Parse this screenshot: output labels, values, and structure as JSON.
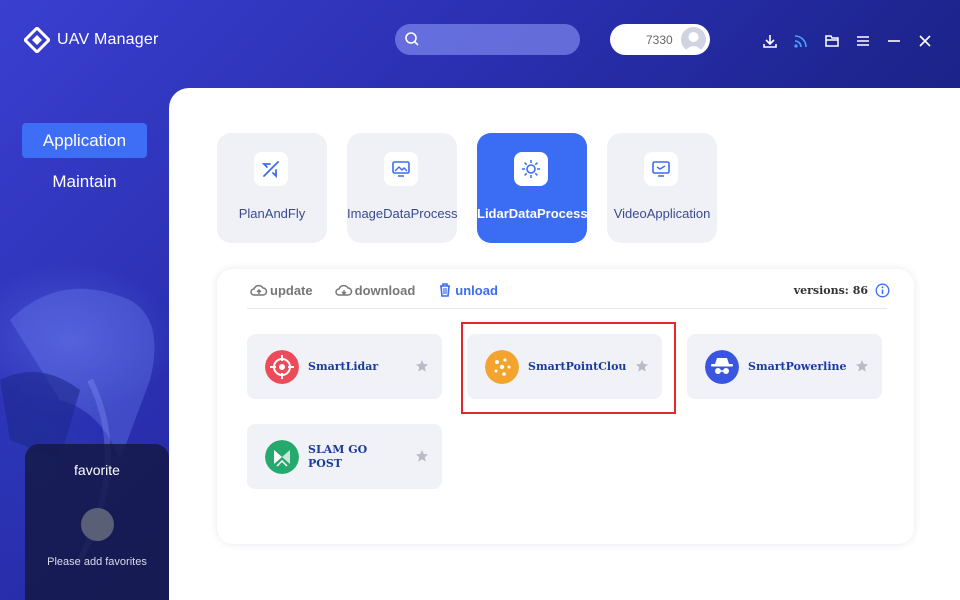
{
  "app": {
    "title": "UAV Manager"
  },
  "search": {
    "placeholder": "",
    "value": ""
  },
  "user": {
    "id": "7330"
  },
  "nav": {
    "items": [
      {
        "label": "Application",
        "active": true
      },
      {
        "label": "Maintain",
        "active": false
      }
    ]
  },
  "favorites": {
    "title": "favorite",
    "empty_hint": "Please add favorites"
  },
  "categories": [
    {
      "label": "PlanAndFly",
      "icon": "airplane-icon",
      "active": false
    },
    {
      "label": "ImageDataProcess",
      "icon": "image-monitor-icon",
      "active": false
    },
    {
      "label": "LidarDataProcess",
      "icon": "lidar-sun-icon",
      "active": true
    },
    {
      "label": "VideoApplication",
      "icon": "video-screen-icon",
      "active": false
    }
  ],
  "subtabs": [
    {
      "label": "update",
      "icon": "cloud-update-icon",
      "active": false
    },
    {
      "label": "download",
      "icon": "cloud-download-icon",
      "active": false
    },
    {
      "label": "unload",
      "icon": "trash-icon",
      "active": true
    }
  ],
  "versions": {
    "label": "versions:",
    "count": "86"
  },
  "apps": [
    {
      "name": "SmartLidar",
      "color": "#ec4b5a",
      "icon": "target-icon"
    },
    {
      "name": "SmartPointClou",
      "color": "#f2a42f",
      "icon": "point-cloud-icon"
    },
    {
      "name": "SmartPowerline",
      "color": "#3a55e0",
      "icon": "spy-icon"
    },
    {
      "name_line1": "SLAM GO",
      "name_line2": "POST",
      "color": "#26a96c",
      "icon": "slam-icon"
    }
  ],
  "colors": {
    "accent": "#3a6cf4",
    "highlight": "#e0282d"
  }
}
